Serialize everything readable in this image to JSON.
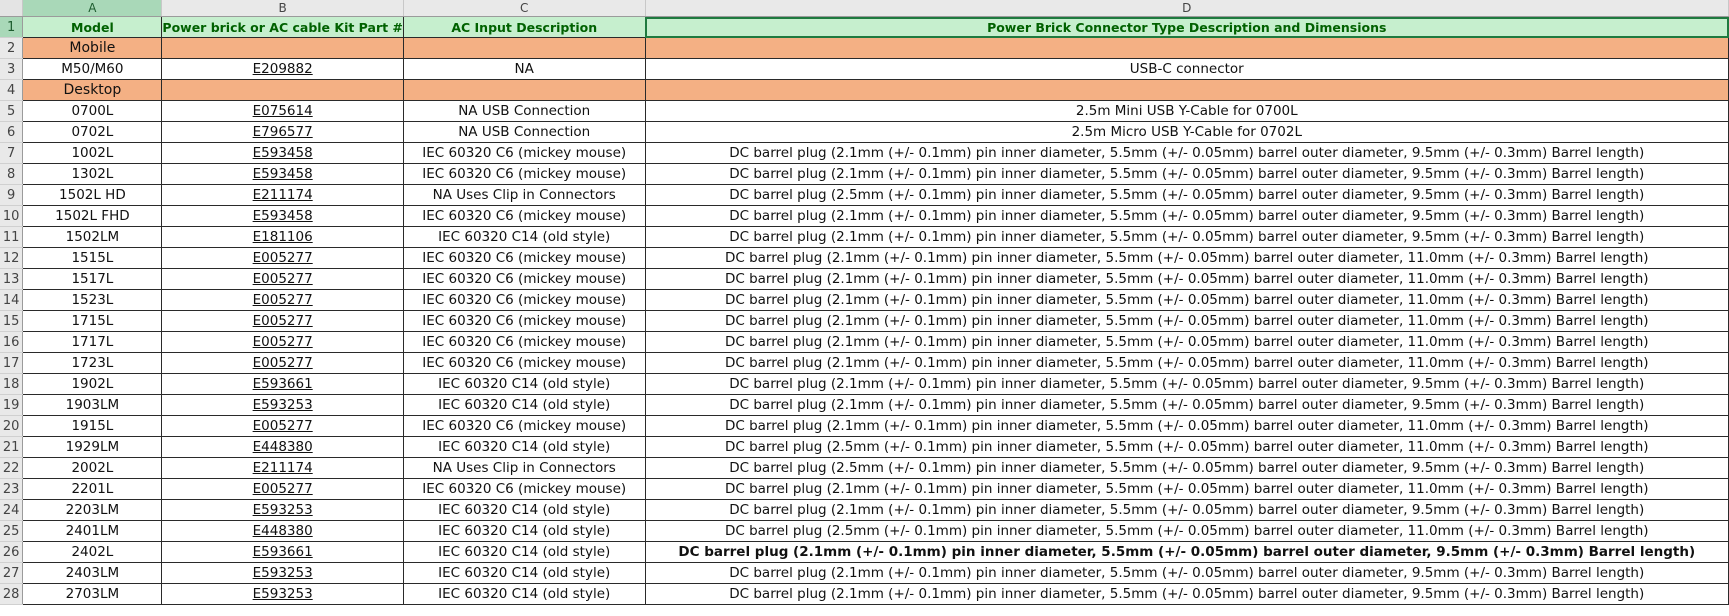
{
  "columns": [
    "A",
    "B",
    "C",
    "D"
  ],
  "headers": {
    "model": "Model",
    "kit_part": "Power brick or AC cable Kit Part #",
    "ac_input": "AC Input Description",
    "connector": "Power Brick Connector Type Description and Dimensions"
  },
  "rows": [
    {
      "n": "2",
      "category": "Mobile"
    },
    {
      "n": "3",
      "model": "M50/M60",
      "part": "E209882",
      "ac": "NA",
      "desc": "USB-C connector"
    },
    {
      "n": "4",
      "category": "Desktop"
    },
    {
      "n": "5",
      "model": "0700L",
      "part": "E075614",
      "ac": "NA USB Connection",
      "desc": "2.5m Mini USB Y-Cable for 0700L"
    },
    {
      "n": "6",
      "model": "0702L",
      "part": "E796577",
      "ac": "NA USB Connection",
      "desc": "2.5m Micro USB Y-Cable for 0702L"
    },
    {
      "n": "7",
      "model": "1002L",
      "part": "E593458",
      "ac": "IEC 60320 C6 (mickey mouse)",
      "desc": "DC barrel plug (2.1mm (+/- 0.1mm) pin inner diameter, 5.5mm (+/- 0.05mm) barrel outer diameter, 9.5mm (+/- 0.3mm) Barrel length)"
    },
    {
      "n": "8",
      "model": "1302L",
      "part": "E593458",
      "ac": "IEC 60320 C6 (mickey mouse)",
      "desc": "DC barrel plug (2.1mm (+/- 0.1mm) pin inner diameter, 5.5mm (+/- 0.05mm) barrel outer diameter, 9.5mm (+/- 0.3mm) Barrel length)"
    },
    {
      "n": "9",
      "model": "1502L HD",
      "part": "E211174",
      "ac": "NA Uses Clip in Connectors",
      "desc": "DC barrel plug (2.5mm (+/- 0.1mm) pin inner diameter, 5.5mm (+/- 0.05mm) barrel outer diameter, 9.5mm (+/- 0.3mm) Barrel length)"
    },
    {
      "n": "10",
      "model": "1502L FHD",
      "part": "E593458",
      "ac": "IEC 60320 C6 (mickey mouse)",
      "desc": "DC barrel plug (2.1mm (+/- 0.1mm) pin inner diameter, 5.5mm (+/- 0.05mm) barrel outer diameter, 9.5mm (+/- 0.3mm) Barrel length)"
    },
    {
      "n": "11",
      "model": "1502LM",
      "part": "E181106",
      "ac": "IEC 60320 C14 (old style)",
      "desc": "DC barrel plug (2.1mm (+/- 0.1mm) pin inner diameter, 5.5mm (+/- 0.05mm) barrel outer diameter, 9.5mm (+/- 0.3mm) Barrel length)"
    },
    {
      "n": "12",
      "model": "1515L",
      "part": "E005277",
      "ac": "IEC 60320 C6 (mickey mouse)",
      "desc": "DC barrel plug (2.1mm (+/- 0.1mm) pin inner diameter, 5.5mm (+/- 0.05mm) barrel outer diameter, 11.0mm (+/- 0.3mm) Barrel length)"
    },
    {
      "n": "13",
      "model": "1517L",
      "part": "E005277",
      "ac": "IEC 60320 C6 (mickey mouse)",
      "desc": "DC barrel plug (2.1mm (+/- 0.1mm) pin inner diameter, 5.5mm (+/- 0.05mm) barrel outer diameter, 11.0mm (+/- 0.3mm) Barrel length)"
    },
    {
      "n": "14",
      "model": "1523L",
      "part": "E005277",
      "ac": "IEC 60320 C6 (mickey mouse)",
      "desc": "DC barrel plug (2.1mm (+/- 0.1mm) pin inner diameter, 5.5mm (+/- 0.05mm) barrel outer diameter, 11.0mm (+/- 0.3mm) Barrel length)"
    },
    {
      "n": "15",
      "model": "1715L",
      "part": "E005277",
      "ac": "IEC 60320 C6 (mickey mouse)",
      "desc": "DC barrel plug (2.1mm (+/- 0.1mm) pin inner diameter, 5.5mm (+/- 0.05mm) barrel outer diameter, 11.0mm (+/- 0.3mm) Barrel length)"
    },
    {
      "n": "16",
      "model": "1717L",
      "part": "E005277",
      "ac": "IEC 60320 C6 (mickey mouse)",
      "desc": "DC barrel plug (2.1mm (+/- 0.1mm) pin inner diameter, 5.5mm (+/- 0.05mm) barrel outer diameter, 11.0mm (+/- 0.3mm) Barrel length)"
    },
    {
      "n": "17",
      "model": "1723L",
      "part": "E005277",
      "ac": "IEC 60320 C6 (mickey mouse)",
      "desc": "DC barrel plug (2.1mm (+/- 0.1mm) pin inner diameter, 5.5mm (+/- 0.05mm) barrel outer diameter, 11.0mm (+/- 0.3mm) Barrel length)"
    },
    {
      "n": "18",
      "model": "1902L",
      "part": "E593661",
      "ac": "IEC 60320 C14 (old style)",
      "desc": "DC barrel plug (2.1mm (+/- 0.1mm) pin inner diameter, 5.5mm (+/- 0.05mm) barrel outer diameter, 9.5mm (+/- 0.3mm) Barrel length)"
    },
    {
      "n": "19",
      "model": "1903LM",
      "part": "E593253",
      "ac": "IEC 60320 C14 (old style)",
      "desc": "DC barrel plug (2.1mm (+/- 0.1mm) pin inner diameter, 5.5mm (+/- 0.05mm) barrel outer diameter, 9.5mm (+/- 0.3mm) Barrel length)"
    },
    {
      "n": "20",
      "model": "1915L",
      "part": "E005277",
      "ac": "IEC 60320 C6 (mickey mouse)",
      "desc": "DC barrel plug (2.1mm (+/- 0.1mm) pin inner diameter, 5.5mm (+/- 0.05mm) barrel outer diameter, 11.0mm (+/- 0.3mm) Barrel length)"
    },
    {
      "n": "21",
      "model": "1929LM",
      "part": "E448380",
      "ac": "IEC 60320 C14 (old style)",
      "desc": "DC barrel plug (2.5mm (+/- 0.1mm) pin inner diameter, 5.5mm (+/- 0.05mm) barrel outer diameter, 11.0mm (+/- 0.3mm) Barrel length)"
    },
    {
      "n": "22",
      "model": "2002L",
      "part": "E211174",
      "ac": "NA Uses Clip in Connectors",
      "desc": "DC barrel plug (2.5mm (+/- 0.1mm) pin inner diameter, 5.5mm (+/- 0.05mm) barrel outer diameter, 9.5mm (+/- 0.3mm) Barrel length)"
    },
    {
      "n": "23",
      "model": "2201L",
      "part": "E005277",
      "ac": "IEC 60320 C6 (mickey mouse)",
      "desc": "DC barrel plug (2.1mm (+/- 0.1mm) pin inner diameter, 5.5mm (+/- 0.05mm) barrel outer diameter, 11.0mm (+/- 0.3mm) Barrel length)"
    },
    {
      "n": "24",
      "model": "2203LM",
      "part": "E593253",
      "ac": "IEC 60320 C14 (old style)",
      "desc": "DC barrel plug (2.1mm (+/- 0.1mm) pin inner diameter, 5.5mm (+/- 0.05mm) barrel outer diameter, 9.5mm (+/- 0.3mm) Barrel length)"
    },
    {
      "n": "25",
      "model": "2401LM",
      "part": "E448380",
      "ac": "IEC 60320 C14 (old style)",
      "desc": "DC barrel plug (2.5mm (+/- 0.1mm) pin inner diameter, 5.5mm (+/- 0.05mm) barrel outer diameter, 11.0mm (+/- 0.3mm) Barrel length)"
    },
    {
      "n": "26",
      "model": "2402L",
      "part": "E593661",
      "ac": "IEC 60320 C14 (old style)",
      "desc": "DC barrel plug (2.1mm (+/- 0.1mm) pin inner diameter, 5.5mm (+/- 0.05mm) barrel outer diameter, 9.5mm (+/- 0.3mm) Barrel length)",
      "desc_bold": true
    },
    {
      "n": "27",
      "model": "2403LM",
      "part": "E593253",
      "ac": "IEC 60320 C14 (old style)",
      "desc": "DC barrel plug (2.1mm (+/- 0.1mm) pin inner diameter, 5.5mm (+/- 0.05mm) barrel outer diameter, 9.5mm (+/- 0.3mm) Barrel length)"
    },
    {
      "n": "28",
      "model": "2703LM",
      "part": "E593253",
      "ac": "IEC 60320 C14 (old style)",
      "desc": "DC barrel plug (2.1mm (+/- 0.1mm) pin inner diameter, 5.5mm (+/- 0.05mm) barrel outer diameter, 9.5mm (+/- 0.3mm) Barrel length)"
    }
  ],
  "colors": {
    "header_fill": "#c6efce",
    "header_text": "#006100",
    "category_fill": "#f4b084",
    "link": "#0563c1"
  }
}
